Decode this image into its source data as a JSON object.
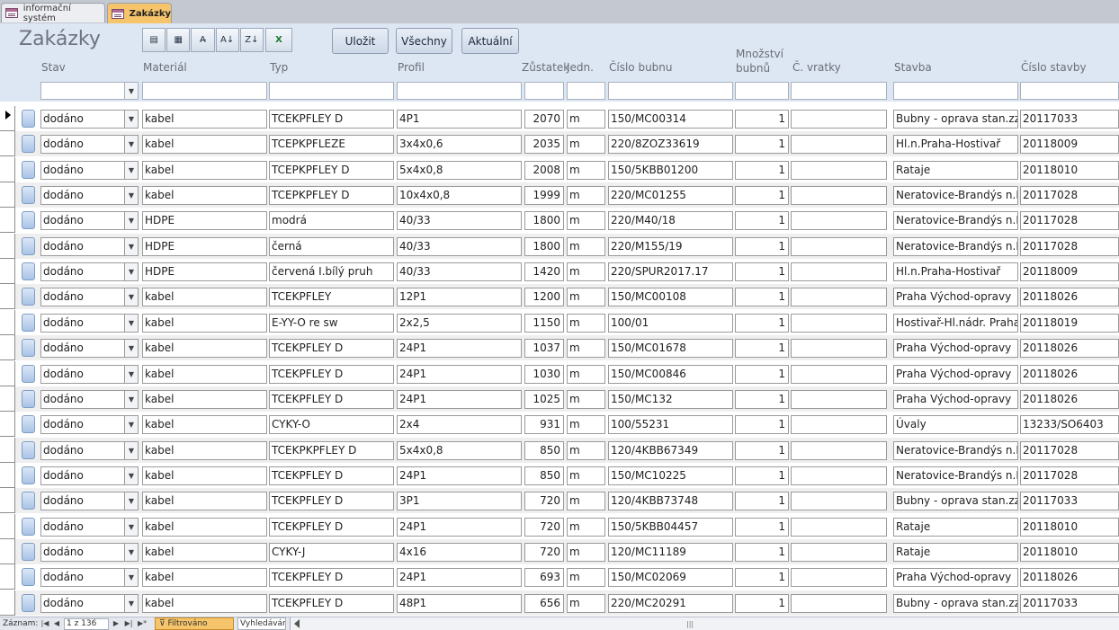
{
  "tabs": [
    {
      "label": "informační systém",
      "active": false
    },
    {
      "label": "Zakázky",
      "active": true
    }
  ],
  "header": {
    "title": "Zakázky",
    "toolbar_icons": [
      "form-view-icon",
      "datasheet-view-icon",
      "find-icon",
      "sort-ascending-icon",
      "sort-descending-icon",
      "export-excel-icon"
    ],
    "buttons": {
      "save": "Uložit",
      "all": "Všechny",
      "current": "Aktuální"
    }
  },
  "columns": {
    "stav": "Stav",
    "material": "Materiál",
    "typ": "Typ",
    "profil": "Profil",
    "zustatek": "Zůstatek",
    "jedn": "Jedn.",
    "cislo_bubnu": "Číslo bubnu",
    "mnozstvi_line1": "Množství",
    "mnozstvi_line2": "bubnů",
    "c_vratky": "Č. vratky",
    "stavba": "Stavba",
    "cislo_stavby": "Číslo stavby"
  },
  "rows": [
    {
      "stav": "dodáno",
      "material": "kabel",
      "typ": "TCEKPFLEY D",
      "profil": "4P1",
      "zustatek": "2070",
      "jedn": "m",
      "cislo_bubnu": "150/MC00314",
      "mnozstvi": "1",
      "vratka": "",
      "stavba": "Bubny - oprava stan.zz",
      "cislo_stavby": "20117033"
    },
    {
      "stav": "dodáno",
      "material": "kabel",
      "typ": "TCEPKPFLEZE",
      "profil": "3x4x0,6",
      "zustatek": "2035",
      "jedn": "m",
      "cislo_bubnu": "220/8ZOZ33619",
      "mnozstvi": "1",
      "vratka": "",
      "stavba": "Hl.n.Praha-Hostivař",
      "cislo_stavby": "20118009"
    },
    {
      "stav": "dodáno",
      "material": "kabel",
      "typ": "TCEPKPFLEY D",
      "profil": "5x4x0,8",
      "zustatek": "2008",
      "jedn": "m",
      "cislo_bubnu": "150/5KBB01200",
      "mnozstvi": "1",
      "vratka": "",
      "stavba": "Rataje",
      "cislo_stavby": "20118010"
    },
    {
      "stav": "dodáno",
      "material": "kabel",
      "typ": "TCEPKPFLEY D",
      "profil": "10x4x0,8",
      "zustatek": "1999",
      "jedn": "m",
      "cislo_bubnu": "220/MC01255",
      "mnozstvi": "1",
      "vratka": "",
      "stavba": "Neratovice-Brandýs n.L.",
      "cislo_stavby": "20117028"
    },
    {
      "stav": "dodáno",
      "material": "HDPE",
      "typ": "modrá",
      "profil": "40/33",
      "zustatek": "1800",
      "jedn": "m",
      "cislo_bubnu": "220/M40/18",
      "mnozstvi": "1",
      "vratka": "",
      "stavba": "Neratovice-Brandýs n.L.",
      "cislo_stavby": "20117028"
    },
    {
      "stav": "dodáno",
      "material": "HDPE",
      "typ": "černá",
      "profil": "40/33",
      "zustatek": "1800",
      "jedn": "m",
      "cislo_bubnu": "220/M155/19",
      "mnozstvi": "1",
      "vratka": "",
      "stavba": "Neratovice-Brandýs n.L.",
      "cislo_stavby": "20117028"
    },
    {
      "stav": "dodáno",
      "material": "HDPE",
      "typ": "červená I.bílý pruh",
      "profil": "40/33",
      "zustatek": "1420",
      "jedn": "m",
      "cislo_bubnu": "220/SPUR2017.17",
      "mnozstvi": "1",
      "vratka": "",
      "stavba": "Hl.n.Praha-Hostivař",
      "cislo_stavby": "20118009"
    },
    {
      "stav": "dodáno",
      "material": "kabel",
      "typ": "TCEKPFLEY",
      "profil": "12P1",
      "zustatek": "1200",
      "jedn": "m",
      "cislo_bubnu": "150/MC00108",
      "mnozstvi": "1",
      "vratka": "",
      "stavba": "Praha Východ-opravy",
      "cislo_stavby": "20118026"
    },
    {
      "stav": "dodáno",
      "material": "kabel",
      "typ": "E-YY-O re sw",
      "profil": "2x2,5",
      "zustatek": "1150",
      "jedn": "m",
      "cislo_bubnu": "100/01",
      "mnozstvi": "1",
      "vratka": "",
      "stavba": "Hostivař-Hl.nádr. Praha I",
      "cislo_stavby": "20118019"
    },
    {
      "stav": "dodáno",
      "material": "kabel",
      "typ": "TCEKPFLEY D",
      "profil": "24P1",
      "zustatek": "1037",
      "jedn": "m",
      "cislo_bubnu": "150/MC01678",
      "mnozstvi": "1",
      "vratka": "",
      "stavba": "Praha Východ-opravy",
      "cislo_stavby": "20118026"
    },
    {
      "stav": "dodáno",
      "material": "kabel",
      "typ": "TCEKPFLEY D",
      "profil": "24P1",
      "zustatek": "1030",
      "jedn": "m",
      "cislo_bubnu": "150/MC00846",
      "mnozstvi": "1",
      "vratka": "",
      "stavba": "Praha Východ-opravy",
      "cislo_stavby": "20118026"
    },
    {
      "stav": "dodáno",
      "material": "kabel",
      "typ": "TCEKPFLEY D",
      "profil": "24P1",
      "zustatek": "1025",
      "jedn": "m",
      "cislo_bubnu": "150/MC132",
      "mnozstvi": "1",
      "vratka": "",
      "stavba": "Praha Východ-opravy",
      "cislo_stavby": "20118026"
    },
    {
      "stav": "dodáno",
      "material": "kabel",
      "typ": "CYKY-O",
      "profil": "2x4",
      "zustatek": "931",
      "jedn": "m",
      "cislo_bubnu": "100/55231",
      "mnozstvi": "1",
      "vratka": "",
      "stavba": "Úvaly",
      "cislo_stavby": "13233/SO6403"
    },
    {
      "stav": "dodáno",
      "material": "kabel",
      "typ": "TCEKPKPFLEY D",
      "profil": "5x4x0,8",
      "zustatek": "850",
      "jedn": "m",
      "cislo_bubnu": "120/4KBB67349",
      "mnozstvi": "1",
      "vratka": "",
      "stavba": "Neratovice-Brandýs n.L.",
      "cislo_stavby": "20117028"
    },
    {
      "stav": "dodáno",
      "material": "kabel",
      "typ": "TCEKPFLEY D",
      "profil": "24P1",
      "zustatek": "850",
      "jedn": "m",
      "cislo_bubnu": "150/MC10225",
      "mnozstvi": "1",
      "vratka": "",
      "stavba": "Neratovice-Brandýs n.L.",
      "cislo_stavby": "20117028"
    },
    {
      "stav": "dodáno",
      "material": "kabel",
      "typ": "TCEKPFLEY D",
      "profil": "3P1",
      "zustatek": "720",
      "jedn": "m",
      "cislo_bubnu": "120/4KBB73748",
      "mnozstvi": "1",
      "vratka": "",
      "stavba": "Bubny - oprava stan.zz",
      "cislo_stavby": "20117033"
    },
    {
      "stav": "dodáno",
      "material": "kabel",
      "typ": "TCEKPFLEY D",
      "profil": "24P1",
      "zustatek": "720",
      "jedn": "m",
      "cislo_bubnu": "150/5KBB04457",
      "mnozstvi": "1",
      "vratka": "",
      "stavba": "Rataje",
      "cislo_stavby": "20118010"
    },
    {
      "stav": "dodáno",
      "material": "kabel",
      "typ": "CYKY-J",
      "profil": "4x16",
      "zustatek": "720",
      "jedn": "m",
      "cislo_bubnu": "120/MC11189",
      "mnozstvi": "1",
      "vratka": "",
      "stavba": "Rataje",
      "cislo_stavby": "20118010"
    },
    {
      "stav": "dodáno",
      "material": "kabel",
      "typ": "TCEKPFLEY D",
      "profil": "24P1",
      "zustatek": "693",
      "jedn": "m",
      "cislo_bubnu": "150/MC02069",
      "mnozstvi": "1",
      "vratka": "",
      "stavba": "Praha Východ-opravy",
      "cislo_stavby": "20118026"
    },
    {
      "stav": "dodáno",
      "material": "kabel",
      "typ": "TCEKPFLEY D",
      "profil": "48P1",
      "zustatek": "656",
      "jedn": "m",
      "cislo_bubnu": "220/MC20291",
      "mnozstvi": "1",
      "vratka": "",
      "stavba": "Bubny - oprava stan.zz",
      "cislo_stavby": "20117033"
    }
  ],
  "statusbar": {
    "record_label": "Záznam:",
    "record_value": "1 z 136",
    "filter_label": "Filtrováno",
    "search_label": "Vyhledávání"
  },
  "colors": {
    "active_tab": "#f6c46a",
    "header_bg": "#dde6f3"
  }
}
